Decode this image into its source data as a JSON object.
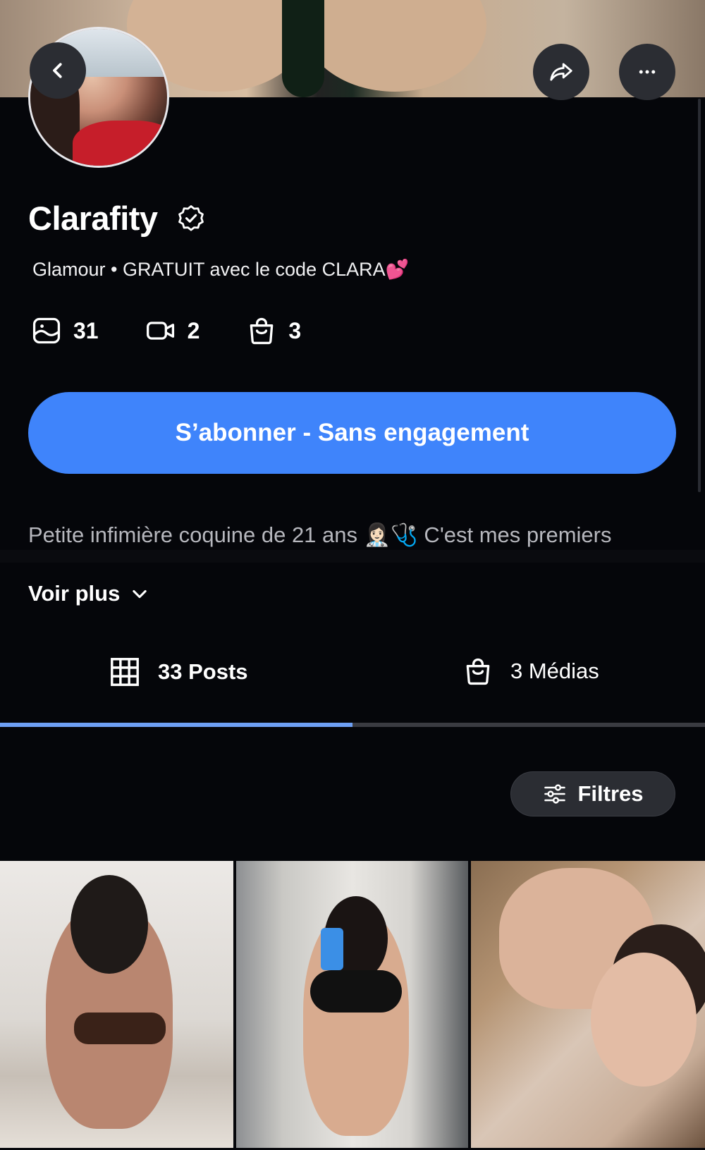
{
  "profile": {
    "name": "Clarafity",
    "tagline": "Glamour • GRATUIT avec le code CLARA💕",
    "stats": {
      "photos": "31",
      "videos": "2",
      "medias": "3"
    },
    "subscribe_label": "S’abonner - Sans engagement",
    "bio": "Petite infimière coquine de 21 ans 👩🏻‍⚕️🩺 C'est mes premiers",
    "see_more_label": "Voir plus"
  },
  "tabs": [
    {
      "label": "33 Posts",
      "active": true
    },
    {
      "label": "3 Médias",
      "active": false
    }
  ],
  "filters_label": "Filtres",
  "colors": {
    "background": "#05060a",
    "accent": "#3f84fb",
    "tab_indicator": "#6ea0f5",
    "button_dark": "#2b2d33"
  },
  "icons": {
    "back": "chevron-left-icon",
    "share": "share-arrow-icon",
    "more": "ellipsis-icon",
    "verified": "verified-badge-icon",
    "photos": "photo-icon",
    "videos": "video-camera-icon",
    "medias": "shopping-bag-icon",
    "posts_tab": "grid-icon",
    "medias_tab": "shopping-bag-icon",
    "filters": "sliders-icon",
    "see_more": "chevron-down-icon"
  }
}
